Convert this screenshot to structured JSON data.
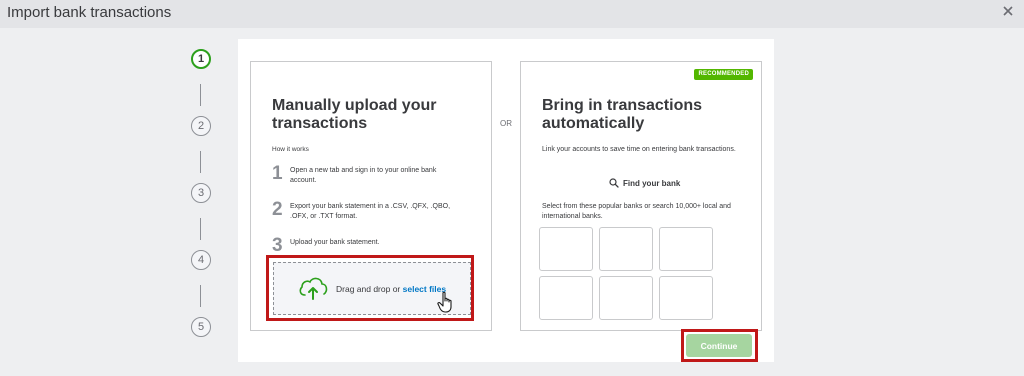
{
  "window": {
    "title": "Import bank transactions"
  },
  "stepper": {
    "steps": [
      "1",
      "2",
      "3",
      "4",
      "5"
    ],
    "active_step": 1
  },
  "manual": {
    "heading": "Manually upload your transactions",
    "how_it_works": "How it works",
    "steps": [
      {
        "num": "1",
        "text": "Open a new tab and sign in to your online bank account."
      },
      {
        "num": "2",
        "text": "Export your bank statement in a .CSV, .QFX, .QBO, .OFX, or .TXT format."
      },
      {
        "num": "3",
        "text": "Upload your bank statement."
      }
    ],
    "drop_text": "Drag and drop or ",
    "select_files": "select files"
  },
  "or_label": "OR",
  "auto": {
    "badge": "RECOMMENDED",
    "heading": "Bring in transactions automatically",
    "description": "Link your accounts to save time on entering bank transactions.",
    "find_bank": "Find your bank",
    "banks_description": "Select from these popular banks or search 10,000+ local and international banks.",
    "bank_tiles": [
      "",
      "",
      "",
      "",
      "",
      ""
    ]
  },
  "footer": {
    "continue_label": "Continue"
  },
  "colors": {
    "accent": "#2ca01c",
    "link": "#0077c5",
    "badge": "#53b700",
    "continue_disabled": "#a6d5a0",
    "highlight": "#c01818"
  }
}
